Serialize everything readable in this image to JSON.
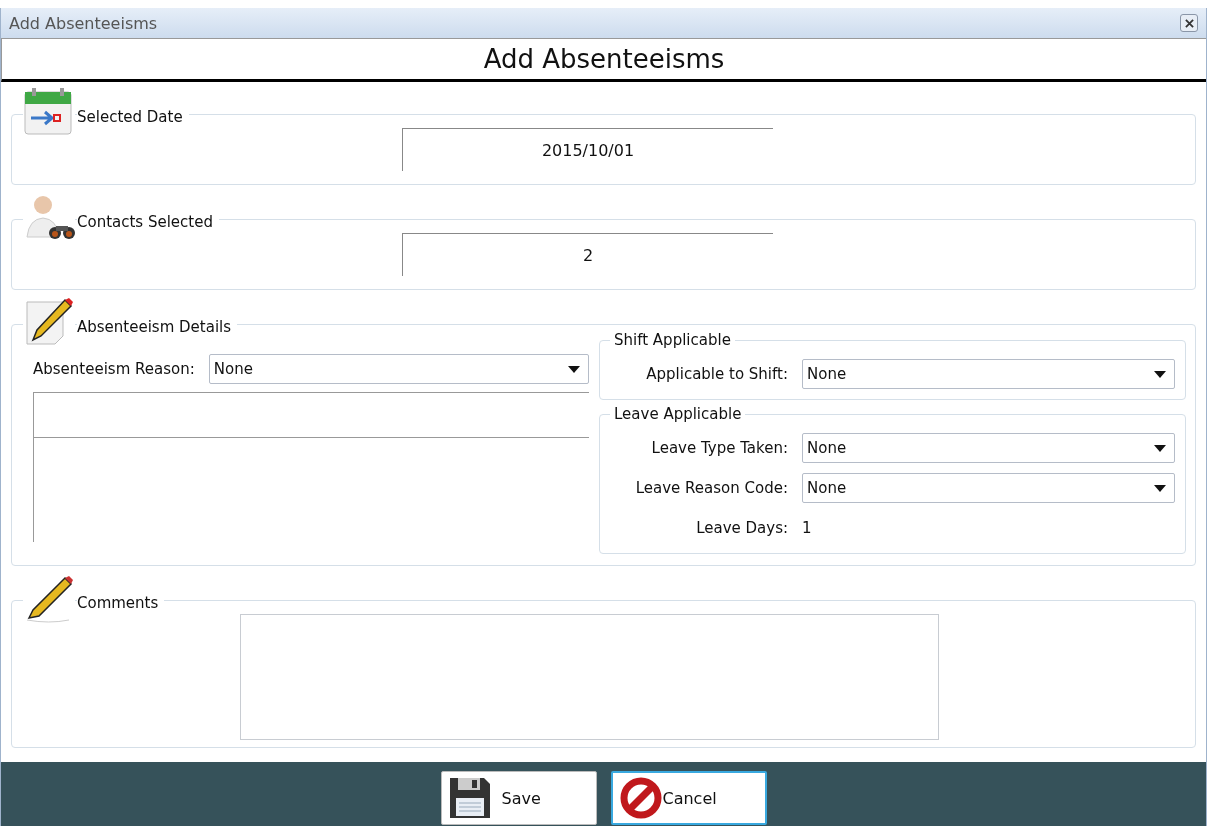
{
  "window": {
    "title": "Add Absenteeisms"
  },
  "heading": "Add Absenteeisms",
  "selected_date": {
    "label": "Selected Date",
    "value": "2015/10/01"
  },
  "contacts_selected": {
    "label": "Contacts Selected",
    "value": "2"
  },
  "absenteeism_details": {
    "label": "Absenteeism Details",
    "reason": {
      "label": "Absenteeism Reason:",
      "value": "None"
    },
    "shift_applicable": {
      "label": "Shift Applicable",
      "fields": [
        {
          "kind": "dropdown",
          "label": "Applicable to Shift:",
          "value": "None"
        }
      ]
    },
    "leave_applicable": {
      "label": "Leave Applicable",
      "fields": [
        {
          "kind": "dropdown",
          "label": "Leave Type Taken:",
          "value": "None"
        },
        {
          "kind": "dropdown",
          "label": "Leave Reason Code:",
          "value": "None"
        },
        {
          "kind": "text",
          "label": "Leave Days:",
          "value": "1"
        }
      ]
    }
  },
  "comments": {
    "label": "Comments"
  },
  "buttons": [
    {
      "kind": "save",
      "label": "Save",
      "focused": false
    },
    {
      "kind": "cancel",
      "label": "Cancel",
      "focused": true
    }
  ]
}
